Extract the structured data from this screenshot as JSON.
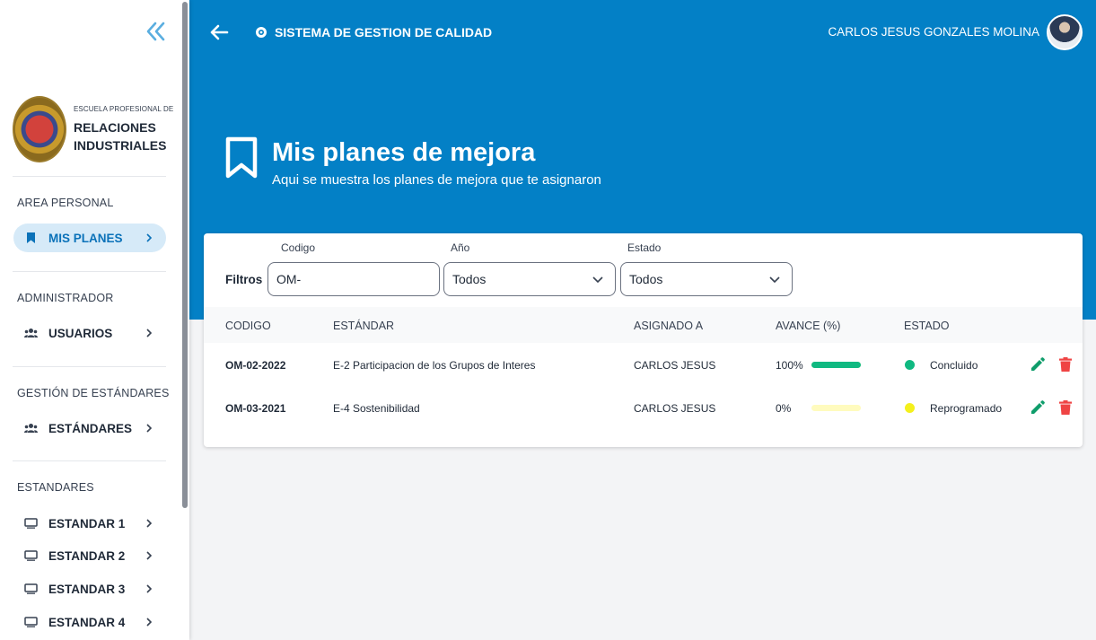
{
  "header": {
    "app_title": "SISTEMA DE GESTION DE CALIDAD",
    "user_name": "CARLOS JESUS GONZALES MOLINA"
  },
  "sidebar": {
    "logo_small": "ESCUELA PROFESIONAL DE",
    "logo_line1": "RELACIONES",
    "logo_line2": "INDUSTRIALES",
    "sections": [
      {
        "title": "AREA PERSONAL",
        "items": [
          {
            "label": "MIS PLANES",
            "icon": "bookmark-icon",
            "active": true
          }
        ]
      },
      {
        "title": "ADMINISTRADOR",
        "items": [
          {
            "label": "USUARIOS",
            "icon": "users-icon"
          }
        ]
      },
      {
        "title": "GESTIÓN DE ESTÁNDARES",
        "items": [
          {
            "label": "ESTÁNDARES",
            "icon": "users-icon"
          }
        ]
      },
      {
        "title": "ESTANDARES",
        "items": [
          {
            "label": "ESTANDAR 1",
            "icon": "monitor-icon"
          },
          {
            "label": "ESTANDAR 2",
            "icon": "monitor-icon"
          },
          {
            "label": "ESTANDAR 3",
            "icon": "monitor-icon"
          },
          {
            "label": "ESTANDAR 4",
            "icon": "monitor-icon"
          }
        ]
      }
    ]
  },
  "page": {
    "title": "Mis planes de mejora",
    "subtitle": "Aqui se muestra los planes de mejora que te asignaron"
  },
  "filters": {
    "label": "Filtros",
    "codigo": {
      "label": "Codigo",
      "value": "OM-"
    },
    "anio": {
      "label": "Año",
      "value": "Todos"
    },
    "estado": {
      "label": "Estado",
      "value": "Todos"
    }
  },
  "table": {
    "columns": [
      "CODIGO",
      "ESTÁNDAR",
      "ASIGNADO A",
      "AVANCE (%)",
      "ESTADO"
    ],
    "rows": [
      {
        "codigo": "OM-02-2022",
        "estandar": "E-2 Participacion de los Grupos de Interes",
        "asignado": "CARLOS JESUS",
        "avance_label": "100%",
        "avance": 100,
        "estado": "Concluido",
        "estado_color": "#10b981"
      },
      {
        "codigo": "OM-03-2021",
        "estandar": "E-4 Sostenibilidad",
        "asignado": "CARLOS JESUS",
        "avance_label": "0%",
        "avance": 0,
        "estado": "Reprogramado",
        "estado_color": "#f4f01c"
      }
    ]
  },
  "colors": {
    "primary": "#0380c6",
    "accent": "#0b72b9",
    "edit": "#0f9d6b",
    "delete": "#ef4444",
    "progress_done": "#10b981",
    "progress_track": "#fffbbe"
  }
}
